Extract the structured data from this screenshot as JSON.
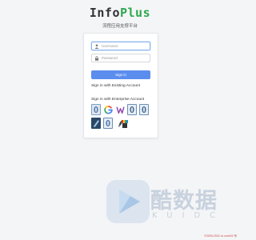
{
  "brand": {
    "name_main": "Info",
    "name_accent": "Plus"
  },
  "subtitle": "流程应用支撑平台",
  "login": {
    "username_placeholder": "Username",
    "password_placeholder": "Password",
    "signin_label": "Sign in",
    "existing_account_link": "Sign in with Existing Account",
    "enterprise_label": "Sign in with Enterprise Account"
  },
  "providers": [
    {
      "icon": "blue-feather-icon"
    },
    {
      "icon": "google-icon"
    },
    {
      "icon": "w-logo-icon"
    },
    {
      "icon": "feather-logo-icon"
    },
    {
      "icon": "feather-logo-icon"
    },
    {
      "icon": "blue-feather-icon"
    },
    {
      "icon": "pen-icon"
    },
    {
      "icon": "dark-feather-icon"
    },
    {
      "icon": "chrome-rainbow-icon"
    }
  ],
  "watermark": {
    "title": "酷数据",
    "subtitle": "KUIDC"
  },
  "footer": "©2009-2022 xx.com/02 号",
  "colors": {
    "accent": "#2fa84f",
    "button": "#5b8def",
    "focus": "#8ab4ee"
  }
}
